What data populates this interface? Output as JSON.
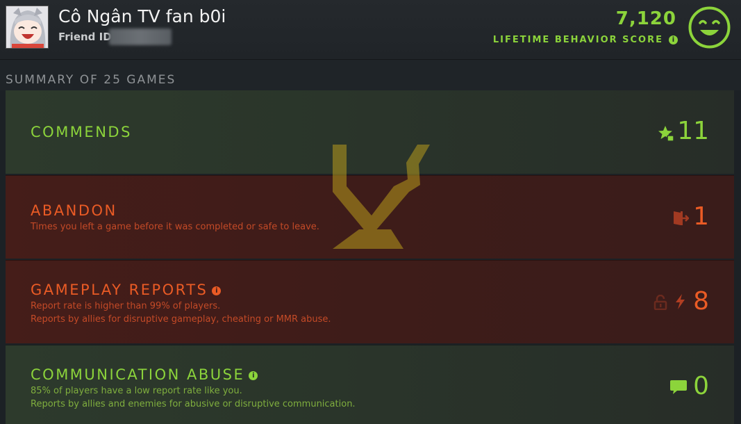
{
  "header": {
    "player_name": "Cô Ngân TV fan b0i",
    "friend_id_label": "Friend ID:",
    "behavior_score": "7,120",
    "behavior_score_label": "LIFETIME BEHAVIOR SCORE",
    "info_glyph": "i",
    "smiley_icon": "smiley-face-icon"
  },
  "summary": {
    "title": "SUMMARY OF 25 GAMES"
  },
  "rows": {
    "commends": {
      "title": "COMMENDS",
      "value": "11",
      "icon": "star-thumbs-up-icon"
    },
    "abandon": {
      "title": "ABANDON",
      "description": "Times you left a game before it was completed or safe to leave.",
      "value": "1",
      "icon": "exit-door-icon"
    },
    "gameplay_reports": {
      "title": "GAMEPLAY REPORTS",
      "description_1": "Report rate is higher than 99% of players.",
      "description_2": "Reports by allies for disruptive gameplay, cheating or MMR abuse.",
      "value": "8",
      "icons": [
        "lock-icon",
        "lightning-icon"
      ]
    },
    "communication_abuse": {
      "title": "COMMUNICATION ABUSE",
      "description_1": "85% of players have a low report rate like you.",
      "description_2": "Reports by allies and enemies for abusive or disruptive communication.",
      "value": "0",
      "icon": "chat-bubble-icon"
    }
  },
  "colors": {
    "positive": "#8cd43b",
    "negative": "#ea5b25",
    "background": "#1f2428"
  }
}
